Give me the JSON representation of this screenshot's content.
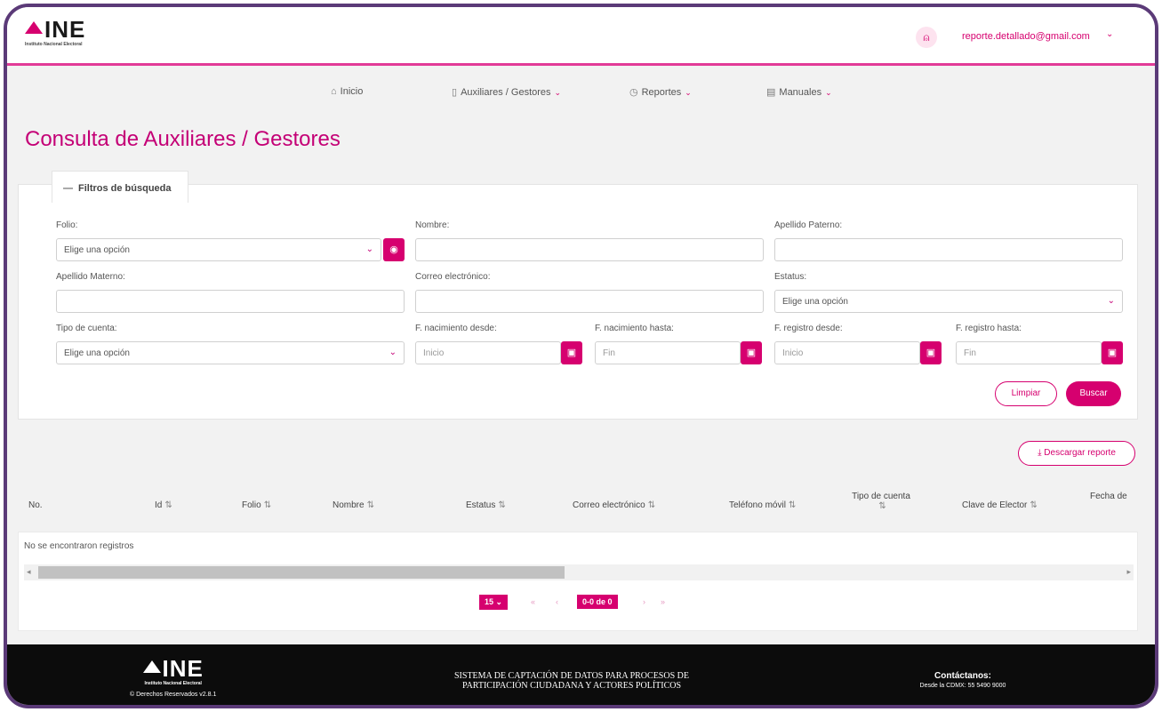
{
  "header": {
    "logo_text": "INE",
    "logo_sub": "Instituto Nacional Electoral",
    "user_icon": "user-icon",
    "user_email": "reporte.detallado@gmail.com",
    "user_caret": "⌄"
  },
  "nav": {
    "items": [
      {
        "icon": "home-icon",
        "glyph": "⌂",
        "label": "Inicio",
        "caret": ""
      },
      {
        "icon": "tablet-icon",
        "glyph": "▯",
        "label": "Auxiliares / Gestores",
        "caret": "⌄"
      },
      {
        "icon": "clock-icon",
        "glyph": "◷",
        "label": "Reportes",
        "caret": "⌄"
      },
      {
        "icon": "file-icon",
        "glyph": "▤",
        "label": "Manuales",
        "caret": "⌄"
      }
    ]
  },
  "page_title": "Consulta de Auxiliares / Gestores",
  "filters": {
    "tab_label": "Filtros de búsqueda",
    "tab_icon": "—",
    "folio_label": "Folio:",
    "folio_value": "Elige una opción",
    "nombre_label": "Nombre:",
    "apellido_paterno_label": "Apellido Paterno:",
    "apellido_materno_label": "Apellido Materno:",
    "correo_label": "Correo electrónico:",
    "estatus_label": "Estatus:",
    "estatus_value": "Elige una opción",
    "tipo_cuenta_label": "Tipo de cuenta:",
    "tipo_cuenta_value": "Elige una opción",
    "fnac_desde_label": "F. nacimiento desde:",
    "fnac_desde_ph": "Inicio",
    "fnac_hasta_label": "F. nacimiento hasta:",
    "fnac_hasta_ph": "Fin",
    "freg_desde_label": "F. registro desde:",
    "freg_desde_ph": "Inicio",
    "freg_hasta_label": "F. registro hasta:",
    "freg_hasta_ph": "Fin",
    "limpiar_label": "Limpiar",
    "buscar_label": "Buscar",
    "caret": "⌄",
    "eye": "◉",
    "cal": "▣"
  },
  "download_label": "⤓ Descargar reporte",
  "table": {
    "columns": [
      "No.",
      "Id",
      "Folio",
      "Nombre",
      "Estatus",
      "Correo electrónico",
      "Teléfono móvil",
      "Tipo de cuenta",
      "Clave de Elector",
      "Fecha de"
    ],
    "sort_glyph": "⇅",
    "empty_message": "No se encontraron registros",
    "left_arrow": "◂",
    "right_arrow": "▸"
  },
  "pagination": {
    "page_size": "15 ⌄",
    "first": "«",
    "prev": "‹",
    "range": "0-0 de 0",
    "next": "›",
    "last": "»"
  },
  "footer": {
    "logo_text": "INE",
    "logo_sub": "Instituto Nacional Electoral",
    "rights": "© Derechos Reservados v2.8.1",
    "system_line1": "SISTEMA DE CAPTACIÓN DE DATOS PARA PROCESOS DE",
    "system_line2": "PARTICIPACIÓN CIUDADANA Y ACTORES POLÍTICOS",
    "contact_title": "Contáctanos:",
    "contact_phone": "Desde la CDMX: 55 5490 9000"
  },
  "colors": {
    "accent": "#d6006f",
    "title": "#c40076",
    "frame": "#5b3a78",
    "footer": "#0c0c0c"
  }
}
